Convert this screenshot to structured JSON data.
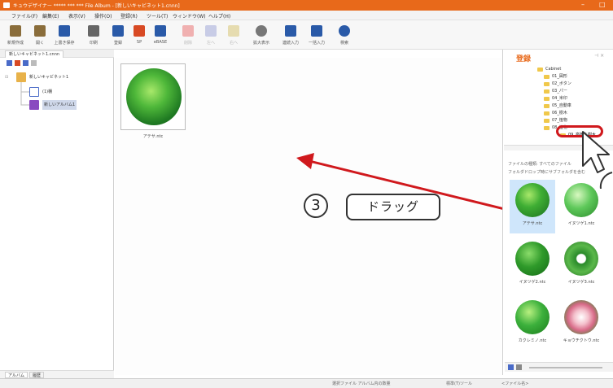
{
  "window": {
    "title": "キュウデザイナー ***** *** *** File Album - [新しいキャビネット1.cnnn]",
    "buttons": [
      "–",
      "□"
    ]
  },
  "menu": [
    "ファイル(F)",
    "編集(E)",
    "表示(V)",
    "操作(O)",
    "登録(R)",
    "ツール(T)",
    "ウィンドウ(W)",
    "ヘルプ(H)"
  ],
  "toolbar": [
    {
      "label": "新規作成",
      "icon": "new-file-icon",
      "color": "#8a6d3b"
    },
    {
      "label": "開く",
      "icon": "open-icon",
      "color": "#8a6d3b"
    },
    {
      "label": "上書き保存",
      "icon": "save-icon",
      "color": "#2a5aa8"
    },
    {
      "label": "印刷",
      "icon": "print-icon",
      "color": "#555555"
    },
    {
      "label": "登録",
      "icon": "register-icon",
      "color": "#2a5aa8"
    },
    {
      "label": "SP",
      "icon": "sp-icon",
      "color": "#d84a24"
    },
    {
      "label": "eBASE",
      "icon": "ebase-icon",
      "color": "#2a5aa8"
    },
    {
      "label": "削除",
      "icon": "delete-icon",
      "color": "#e58080"
    },
    {
      "label": "左へ",
      "icon": "left-icon",
      "color": "#aab0d8"
    },
    {
      "label": "右へ",
      "icon": "right-icon",
      "color": "#d8c890"
    },
    {
      "label": "拡大表示",
      "icon": "zoom-view-icon",
      "color": "#555555"
    },
    {
      "label": "連続入力",
      "icon": "continuous-input-icon",
      "color": "#2a5aa8"
    },
    {
      "label": "一括入力",
      "icon": "batch-input-icon",
      "color": "#2a5aa8"
    },
    {
      "label": "検索",
      "icon": "search-icon",
      "color": "#2a5aa8"
    }
  ],
  "left_panel": {
    "doc_tab": "新しいキャビネット1.cnnn",
    "tree": [
      {
        "label": "新しいキャビネット1",
        "icon": "cabinet-icon"
      },
      {
        "label": "(1)棚",
        "icon": "shelf-icon"
      },
      {
        "label": "新しいアルバム1",
        "icon": "album-icon"
      }
    ],
    "bottom_tabs": [
      "アルバム",
      "履歴"
    ]
  },
  "main": {
    "thumbnail": {
      "name": "アテサ.ntc"
    }
  },
  "annotation": {
    "step": "3",
    "label": "ドラッグ"
  },
  "right_panel": {
    "title": "登録",
    "folders": [
      "Cabinet",
      "01_図形",
      "02_植栽",
      "03_パース",
      "04_外構",
      "05_住宅",
      "06_植木",
      "07_樹木",
      "08_高植木",
      "09_高植木"
    ],
    "folder_labels": [
      "Cabinet",
      "01_図形",
      "02_ボタン",
      "03_パー",
      "04_米印",
      "05_自動車",
      "06_樹木",
      "07_植物",
      "08_植物",
      "09_高植え樹木"
    ],
    "highlighted_folder": "09_高植え樹木",
    "file_type_label": "ファイルの種類: すべてのファイル",
    "subfolder_label": "フォルダドロップ時にサブフォルダを含む",
    "files": [
      {
        "name": "アテサ.ntc",
        "color": "#2e9a2e",
        "selected": true
      },
      {
        "name": "イヌツゲ1.ntc",
        "color": "#3aa83a",
        "selected": false
      },
      {
        "name": "イヌツゲ2.ntc",
        "color": "#2f8f2f",
        "selected": false
      },
      {
        "name": "イヌツゲ3.ntc",
        "color": "#3c9a3c",
        "selected": false
      },
      {
        "name": "カクレミノ.ntc",
        "color": "#2aa02a",
        "selected": false
      },
      {
        "name": "キョウチクトウ.ntc",
        "color": "#e8a0b0",
        "selected": false
      }
    ]
  },
  "status_bar": {
    "items": [
      "選択ファイル  アルバム内の数量",
      "標準(T)ツール",
      "<ファイル名>"
    ]
  },
  "colors": {
    "accent": "#e8691a",
    "highlight": "#d0191d",
    "arrow": "#d0191d"
  }
}
